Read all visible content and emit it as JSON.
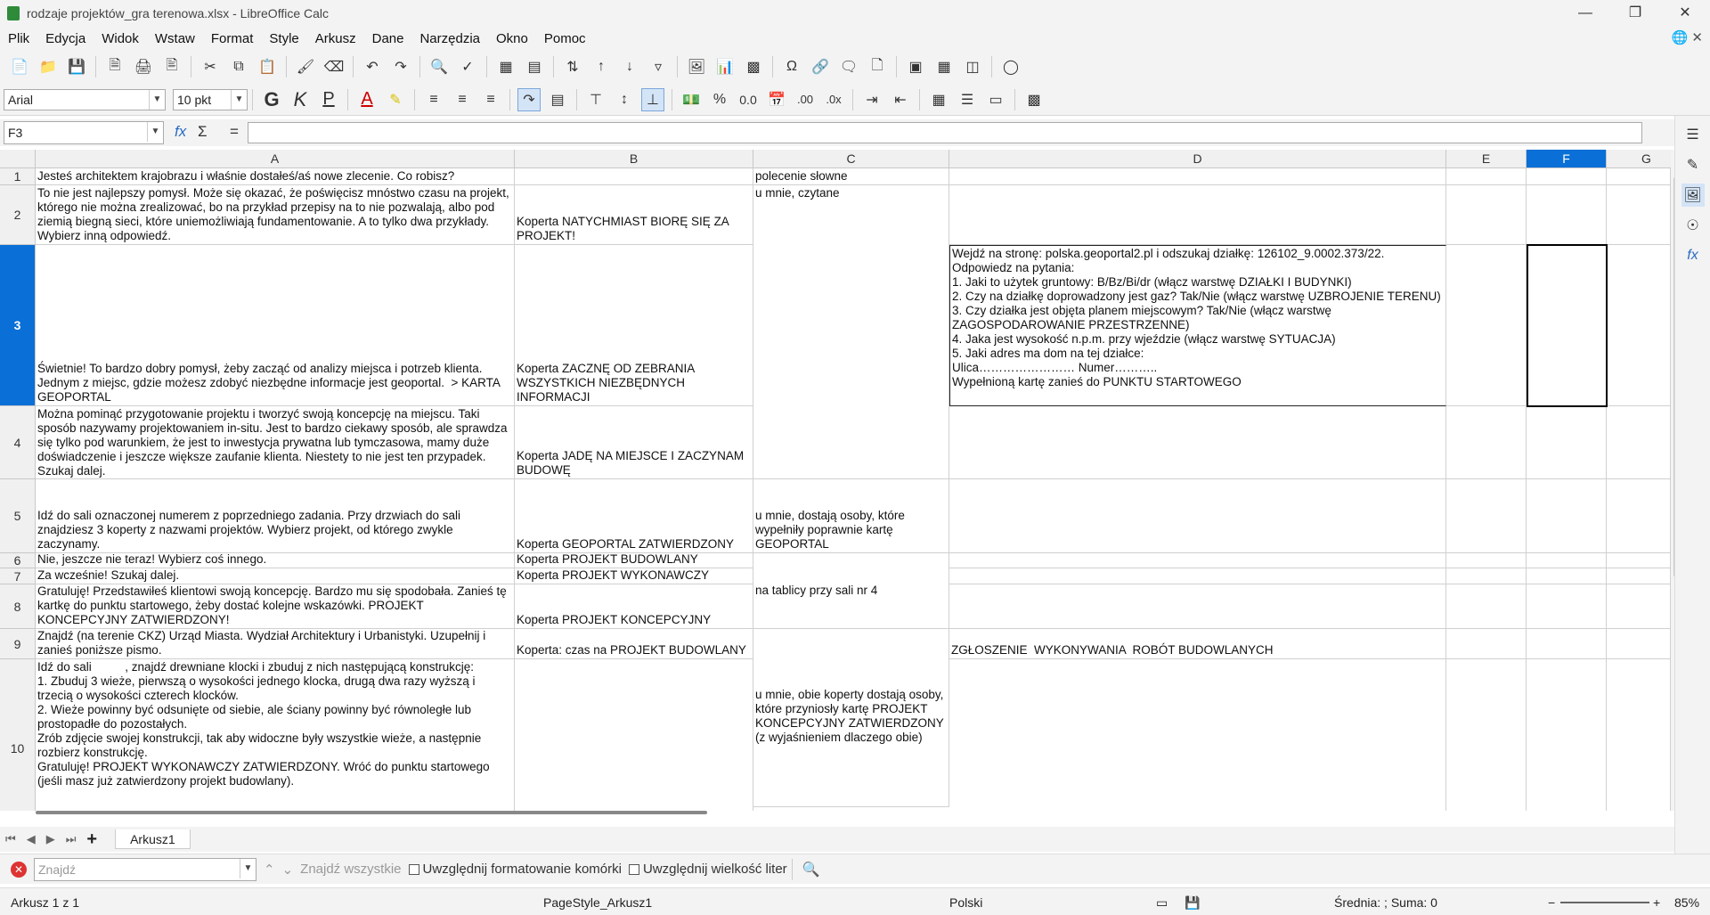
{
  "window": {
    "title": "rodzaje projektów_gra terenowa.xlsx - LibreOffice Calc"
  },
  "menu": [
    "Plik",
    "Edycja",
    "Widok",
    "Wstaw",
    "Format",
    "Style",
    "Arkusz",
    "Dane",
    "Narzędzia",
    "Okno",
    "Pomoc"
  ],
  "toolbar": {
    "font_name": "Arial",
    "font_size": "10 pkt"
  },
  "formula_bar": {
    "name_box": "F3",
    "fx": "fx",
    "sigma": "Σ",
    "equals": "=",
    "content": ""
  },
  "columns": [
    "A",
    "B",
    "C",
    "D",
    "E",
    "F",
    "G"
  ],
  "selected_column": "F",
  "selected_row": "3",
  "rows": [
    "1",
    "2",
    "3",
    "4",
    "5",
    "6",
    "7",
    "8",
    "9",
    "10"
  ],
  "cells": {
    "A1": "Jesteś architektem krajobrazu i właśnie dostałeś/aś nowe zlecenie. Co robisz?",
    "C1": "polecenie słowne",
    "A2": "To nie jest najlepszy pomysł. Może się okazać, że poświęcisz mnóstwo czasu na projekt, którego nie można zrealizować, bo na przykład przepisy na to nie pozwalają, albo pod ziemią biegną sieci, które uniemożliwiają fundamentowanie. A to tylko dwa przykłady. Wybierz inną odpowiedź.",
    "B2": "Koperta NATYCHMIAST BIORĘ SIĘ ZA PROJEKT!",
    "C2": "u mnie, czytane",
    "A3": "Świetnie! To bardzo dobry pomysł, żeby zacząć od analizy miejsca i potrzeb klienta. Jednym z miejsc, gdzie możesz zdobyć niezbędne informacje jest geoportal.  > KARTA GEOPORTAL",
    "B3": "Koperta ZACZNĘ OD ZEBRANIA WSZYSTKICH NIEZBĘDNYCH INFORMACJI",
    "D3": "Wejdź na stronę: polska.geoportal2.pl i odszukaj działkę: 126102_9.0002.373/22.\nOdpowiedz na pytania:\n1. Jaki to użytek gruntowy: B/Bz/Bi/dr (włącz warstwę DZIAŁKI I BUDYNKI)\n2. Czy na działkę doprowadzony jest gaz? Tak/Nie (włącz warstwę UZBROJENIE TERENU)\n3. Czy działka jest objęta planem miejscowym? Tak/Nie (włącz warstwę ZAGOSPODAROWANIE PRZESTRZENNE)\n4. Jaka jest wysokość n.p.m. przy wjeździe (włącz warstwę SYTUACJA)\n5. Jaki adres ma dom na tej działce:\nUlica…………………… Numer………..\nWypełnioną kartę zanieś do PUNKTU STARTOWEGO",
    "A4": "Można pominąć przygotowanie projektu i tworzyć swoją koncepcję na miejscu. Taki sposób nazywamy projektowaniem in-situ. Jest to bardzo ciekawy sposób, ale sprawdza się tylko pod warunkiem, że jest to inwestycja prywatna lub tymczasowa, mamy duże doświadczenie i jeszcze większe zaufanie klienta. Niestety to nie jest ten przypadek. Szukaj dalej.",
    "B4": "Koperta JADĘ NA MIEJSCE I ZACZYNAM BUDOWĘ",
    "A5": "Idź do sali oznaczonej numerem z poprzedniego zadania. Przy drzwiach do sali znajdziesz 3 koperty z nazwami projektów. Wybierz projekt, od którego zwykle zaczynamy.",
    "B5": "Koperta GEOPORTAL ZATWIERDZONY",
    "C5": "u mnie, dostają osoby, które wypełniły poprawnie kartę GEOPORTAL",
    "A6": "Nie, jeszcze nie teraz! Wybierz coś innego.",
    "B6": "Koperta PROJEKT BUDOWLANY",
    "A7": "Za wcześnie! Szukaj dalej.",
    "B7": "Koperta PROJEKT WYKONAWCZY",
    "C8": "na tablicy przy sali nr 4",
    "A8": "Gratuluję! Przedstawiłeś klientowi swoją koncepcję. Bardzo mu się spodobała. Zanieś tę kartkę do punktu startowego, żeby dostać kolejne wskazówki. PROJEKT KONCEPCYJNY ZATWIERDZONY!",
    "B8": "Koperta PROJEKT KONCEPCYJNY",
    "A9": "Znajdź (na terenie CKZ) Urząd Miasta. Wydział Architektury i Urbanistyki. Uzupełnij i zanieś poniższe pismo.",
    "B9": "Koperta: czas na PROJEKT BUDOWLANY",
    "D9": "ZGŁOSZENIE  WYKONYWANIA  ROBÓT BUDOWLANYCH",
    "A10": "Idź do sali          , znajdź drewniane klocki i zbuduj z nich następującą konstrukcję:\n1. Zbuduj 3 wieże, pierwszą o wysokości jednego klocka, drugą dwa razy wyższą i trzecią o wysokości czterech klocków.\n2. Wieże powinny być odsunięte od siebie, ale ściany powinny być równoległe lub prostopadłe do pozostałych.\nZrób zdjęcie swojej konstrukcji, tak aby widoczne były wszystkie wieże, a następnie rozbierz konstrukcję.\nGratuluję! PROJEKT WYKONAWCZY ZATWIERDZONY. Wróć do punktu startowego (jeśli masz już zatwierdzony projekt budowlany).",
    "C10": "u mnie, obie koperty dostają osoby, które przyniosły kartę PROJEKT KONCEPCYJNY ZATWIERDZONY\n(z wyjaśnieniem dlaczego obie)"
  },
  "sheet_tab": "Arkusz1",
  "findbar": {
    "placeholder": "Znajdź",
    "find_all": "Znajdź wszystkie",
    "opt_format": "Uwzględnij formatowanie komórki",
    "opt_case": "Uwzględnij wielkość liter"
  },
  "status": {
    "sheet": "Arkusz 1 z 1",
    "page_style": "PageStyle_Arkusz1",
    "language": "Polski",
    "summary": "Średnia: ; Suma: 0",
    "zoom": "85%"
  }
}
